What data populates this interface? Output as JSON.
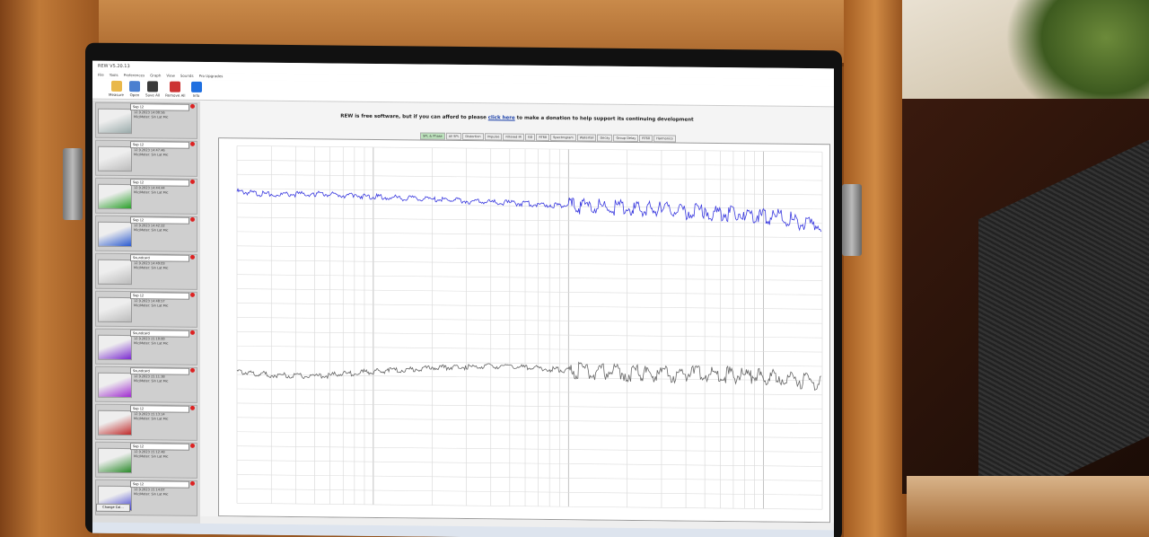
{
  "app": {
    "title": "REW V5.20.13"
  },
  "menu": [
    "File",
    "Tools",
    "Preferences",
    "Graph",
    "View",
    "Sounds",
    "Pro Upgrades"
  ],
  "toolbar": [
    {
      "label": "Measure",
      "color": "#e9b84a"
    },
    {
      "label": "Open",
      "color": "#4a7fd0"
    },
    {
      "label": "Save All",
      "color": "#3a3a3a"
    },
    {
      "label": "Remove All",
      "color": "#c33"
    },
    {
      "label": "Info",
      "color": "#1f6fe0"
    }
  ],
  "banner": {
    "prefix": "REW is free software, but if you can afford to please",
    "link": "click here",
    "suffix": "to make a donation to help support its continuing development"
  },
  "tabs": [
    "SPL & Phase",
    "All SPL",
    "Distortion",
    "Impulse",
    "Filtered IR",
    "GD",
    "RT60",
    "Spectrogram",
    "Waterfall",
    "Decay",
    "Group Delay",
    "RT60",
    "Harmonics"
  ],
  "active_tab": "SPL & Phase",
  "measurements": [
    {
      "name": "Sep 12",
      "date": "12.9.2023 14:00:56",
      "mic": "Mic/Meter: Sin Lat Mic",
      "color": "#9aa"
    },
    {
      "name": "Sep 12",
      "date": "12.9.2023 14:47:46",
      "mic": "Mic/Meter: Sin Lat Mic",
      "color": "#bbb"
    },
    {
      "name": "Sep 12",
      "date": "12.9.2023 14:44:44",
      "mic": "Mic/Meter: Sin Lat Mic",
      "color": "#2aa02a"
    },
    {
      "name": "Sep 12",
      "date": "12.9.2023 14:42:22",
      "mic": "Mic/Meter: Sin Lat Mic",
      "color": "#2a5ad0"
    },
    {
      "name": "Soundcard",
      "date": "12.9.2023 14:49:03",
      "mic": "Mic/Meter: Sin Lat Mic",
      "color": "#bbb"
    },
    {
      "name": "Sep 12",
      "date": "12.9.2023 14:48:57",
      "mic": "Mic/Meter: Sin Lat Mic",
      "color": "#bbb"
    },
    {
      "name": "Soundcard",
      "date": "12.9.2023 15:10:00",
      "mic": "Mic/Meter: Sin Lat Mic",
      "color": "#7a2ad0"
    },
    {
      "name": "Soundcard",
      "date": "12.9.2023 15:11:38",
      "mic": "Mic/Meter: Sin Lat Mic",
      "color": "#a02ad0"
    },
    {
      "name": "Sep 12",
      "date": "12.9.2023 15:13:14",
      "mic": "Mic/Meter: Sin Lat Mic",
      "color": "#c02a2a"
    },
    {
      "name": "Sep 12",
      "date": "12.9.2023 15:12:48",
      "mic": "Mic/Meter: Sin Lat Mic",
      "color": "#2a8a2a"
    },
    {
      "name": "Sep 12",
      "date": "12.9.2023 15:14:07",
      "mic": "Mic/Meter: Sin Lat Mic",
      "color": "#3a3ad0"
    }
  ],
  "change_button": "Change Cal...",
  "chart_data": {
    "type": "line",
    "xscale": "log",
    "xlim": [
      20,
      20000
    ],
    "ylim": [
      -210,
      40
    ],
    "grid": true,
    "series": [
      {
        "color": "#3a3adf",
        "x": [
          20,
          30,
          50,
          80,
          120,
          200,
          300,
          500,
          800,
          1200,
          2000,
          3000,
          5000,
          8000,
          12000,
          20000
        ],
        "y": [
          8,
          6,
          7,
          6,
          5,
          4,
          3,
          2,
          1,
          0,
          -1,
          -2,
          -3,
          -4,
          -6,
          -12
        ]
      },
      {
        "color": "#666666",
        "x": [
          20,
          30,
          50,
          80,
          120,
          200,
          300,
          500,
          800,
          1200,
          2000,
          3000,
          5000,
          8000,
          12000,
          20000
        ],
        "y": [
          -118,
          -120,
          -121,
          -118,
          -116,
          -114,
          -113,
          -112,
          -114,
          -115,
          -116,
          -117,
          -116,
          -117,
          -118,
          -122
        ]
      }
    ]
  }
}
